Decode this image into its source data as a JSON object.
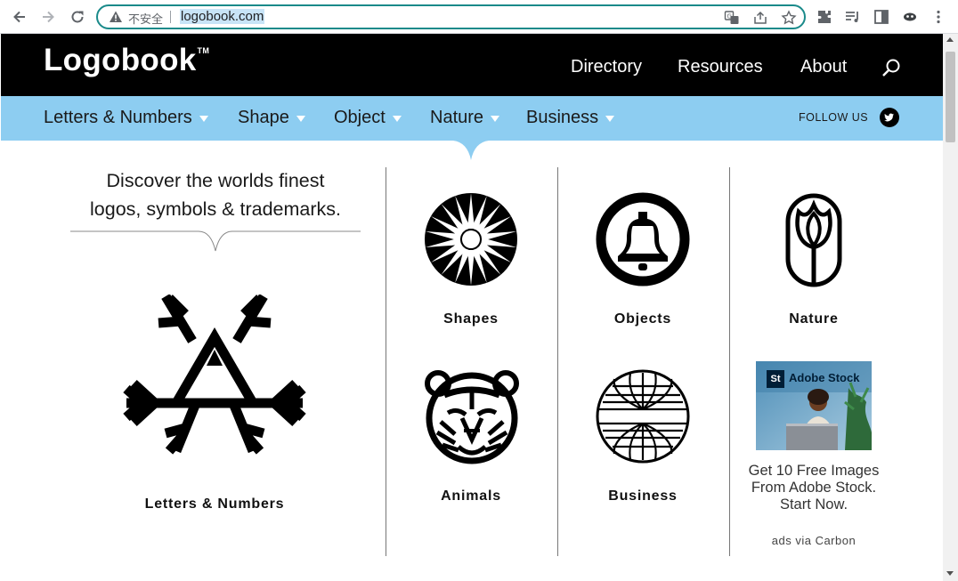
{
  "browser": {
    "insecure_label": "不安全",
    "url": "logobook.com"
  },
  "site": {
    "logo": "Logobook",
    "logo_tm": "TM",
    "topnav": [
      "Directory",
      "Resources",
      "About"
    ],
    "subnav": [
      "Letters & Numbers",
      "Shape",
      "Object",
      "Nature",
      "Business"
    ],
    "follow_label": "FOLLOW US"
  },
  "hero": {
    "tagline_line1": "Discover the worlds finest",
    "tagline_line2": "logos, symbols & trademarks.",
    "feature_label": "Letters & Numbers"
  },
  "categories": [
    "Shapes",
    "Objects",
    "Nature",
    "Animals",
    "Business"
  ],
  "ad": {
    "brand": "Adobe Stock",
    "brand_badge": "St",
    "text": "Get 10 Free Images From Adobe Stock. Start Now.",
    "via": "ads via Carbon"
  },
  "colors": {
    "topbar": "#000000",
    "subbar": "#8dcdf1",
    "omnibox_border": "#1a8a8a"
  }
}
